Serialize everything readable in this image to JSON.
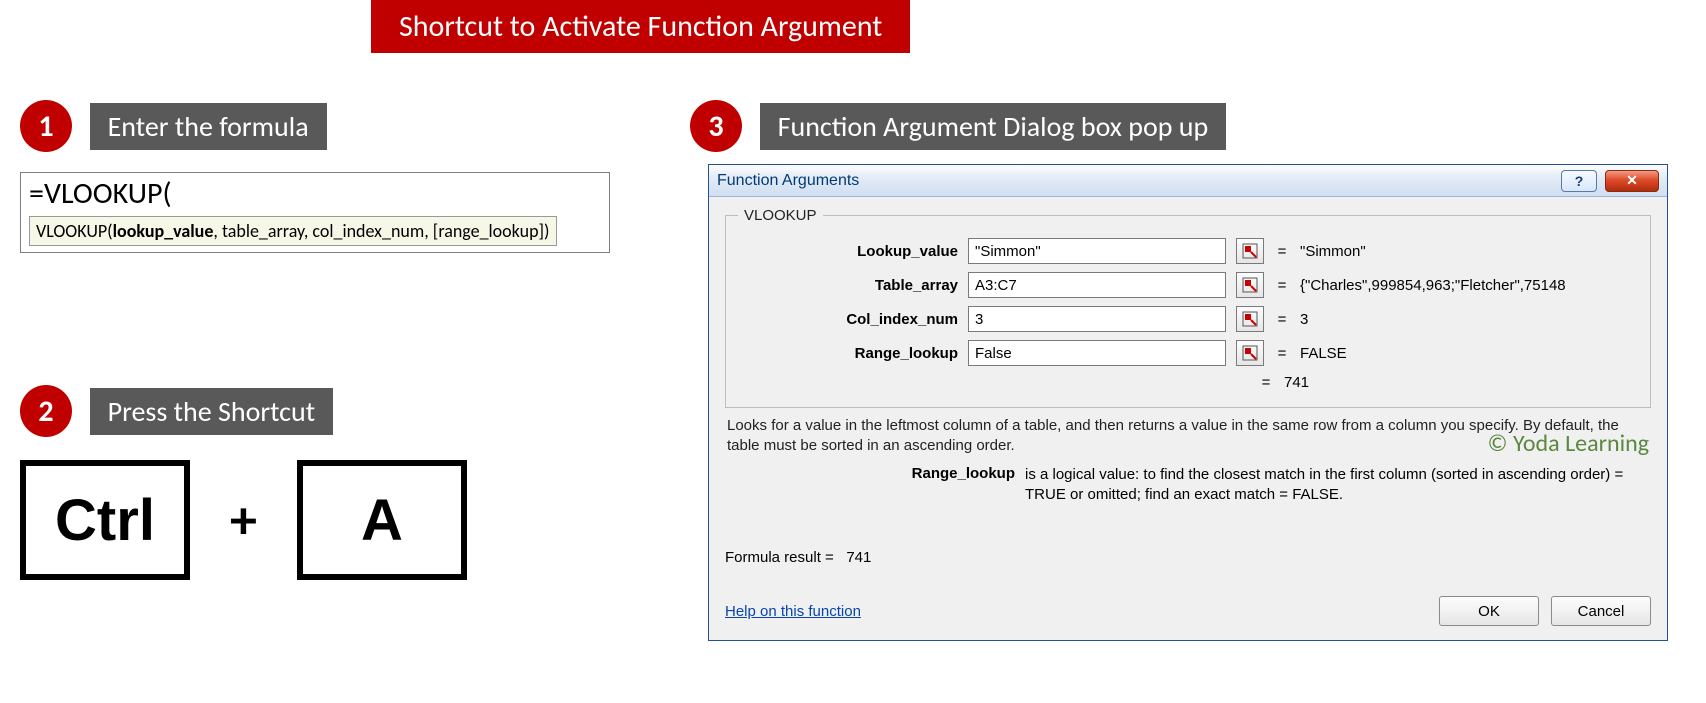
{
  "title": "Shortcut to Activate Function Argument",
  "steps": {
    "s1": {
      "num": "1",
      "label": "Enter the formula"
    },
    "s2": {
      "num": "2",
      "label": "Press the Shortcut"
    },
    "s3": {
      "num": "3",
      "label": "Function Argument Dialog box pop up"
    }
  },
  "formula": {
    "typed": "=VLOOKUP(",
    "tooltip_fn": "VLOOKUP(",
    "tooltip_bold": "lookup_value",
    "tooltip_rest": ", table_array, col_index_num, [range_lookup])"
  },
  "keys": {
    "k1": "Ctrl",
    "plus": "+",
    "k2": "A"
  },
  "dialog": {
    "title": "Function Arguments",
    "fn_name": "VLOOKUP",
    "args": [
      {
        "label": "Lookup_value",
        "value": "\"Simmon\"",
        "result": "\"Simmon\""
      },
      {
        "label": "Table_array",
        "value": "A3:C7",
        "result": "{\"Charles\",999854,963;\"Fletcher\",75148"
      },
      {
        "label": "Col_index_num",
        "value": "3",
        "result": "3"
      },
      {
        "label": "Range_lookup",
        "value": "False",
        "result": "FALSE"
      }
    ],
    "overall_eq": "=",
    "overall_result": "741",
    "description": "Looks for a value in the leftmost column of a table, and then returns a value in the same row from a column you specify. By default, the table must be sorted in an ascending order.",
    "param_name": "Range_lookup",
    "param_text": "is a logical value: to find the closest match in the first column (sorted in ascending order) = TRUE or omitted; find an exact match = FALSE.",
    "formula_result_label": "Formula result =",
    "formula_result_value": "741",
    "help": "Help on this function",
    "ok": "OK",
    "cancel": "Cancel",
    "help_btn": "?",
    "close_btn": "✕"
  },
  "watermark": "© Yoda Learning"
}
